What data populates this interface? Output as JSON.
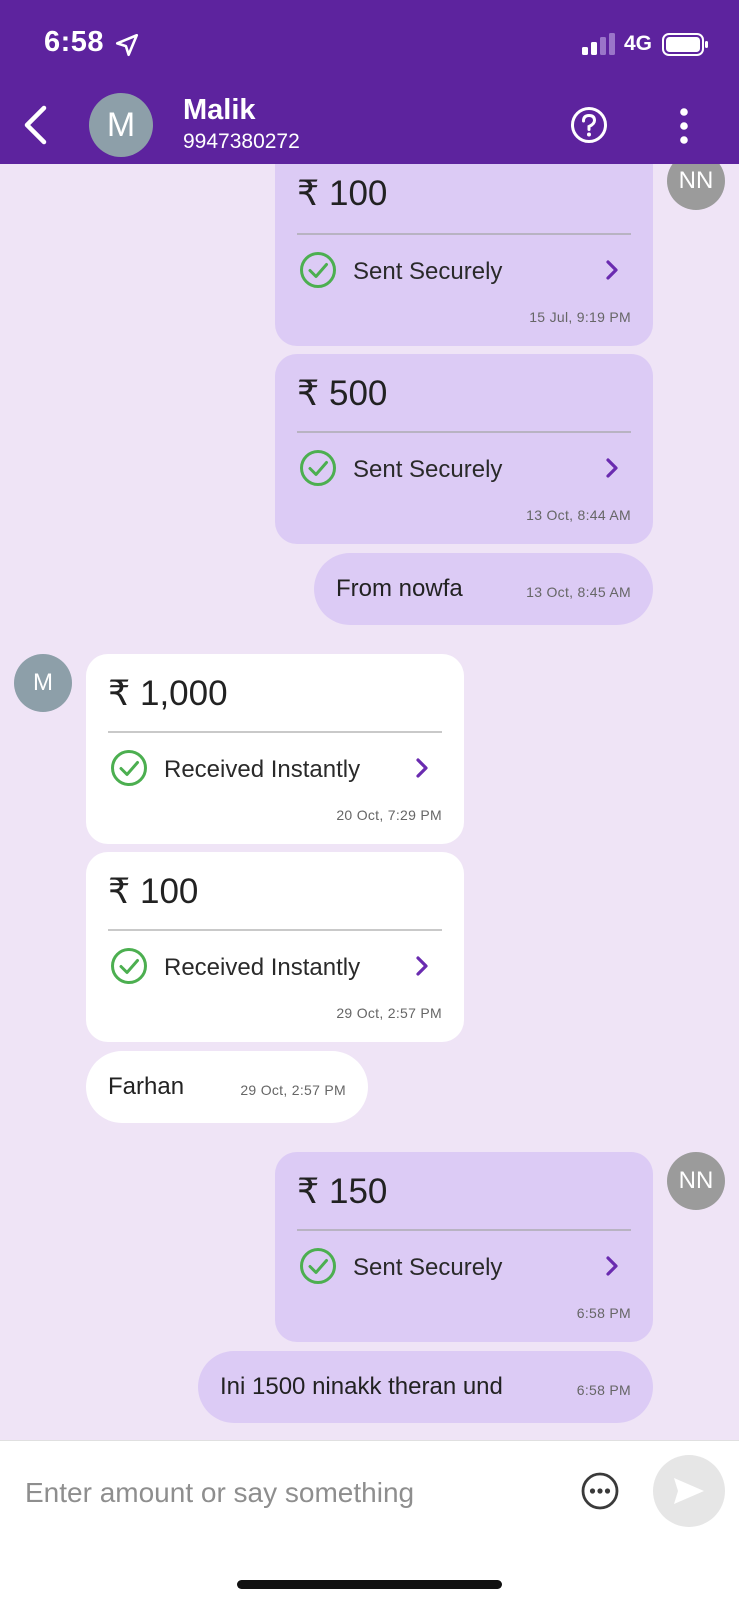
{
  "status_bar": {
    "time": "6:58",
    "network": "4G"
  },
  "header": {
    "contact_name": "Malik",
    "contact_phone": "9947380272",
    "avatar_initial": "M"
  },
  "avatars": {
    "self": "NN",
    "contact": "M"
  },
  "messages": [
    {
      "type": "payment",
      "direction": "sent",
      "amount": "₹ 100",
      "status": "Sent Securely",
      "time": "15 Jul, 9:19 PM"
    },
    {
      "type": "payment",
      "direction": "sent",
      "amount": "₹ 500",
      "status": "Sent Securely",
      "time": "13 Oct, 8:44 AM"
    },
    {
      "type": "text",
      "direction": "sent",
      "text": "From nowfa",
      "time": "13 Oct, 8:45 AM"
    },
    {
      "type": "payment",
      "direction": "received",
      "amount": "₹ 1,000",
      "status": "Received Instantly",
      "time": "20 Oct, 7:29 PM"
    },
    {
      "type": "payment",
      "direction": "received",
      "amount": "₹ 100",
      "status": "Received Instantly",
      "time": "29 Oct, 2:57 PM"
    },
    {
      "type": "text",
      "direction": "received",
      "text": "Farhan",
      "time": "29 Oct, 2:57 PM"
    },
    {
      "type": "payment",
      "direction": "sent",
      "amount": "₹ 150",
      "status": "Sent Securely",
      "time": "6:58 PM"
    },
    {
      "type": "text",
      "direction": "sent",
      "text": "Ini 1500 ninakk theran und",
      "time": "6:58 PM"
    }
  ],
  "composer": {
    "placeholder": "Enter amount or say something"
  },
  "colors": {
    "brand": "#5d239e",
    "sent_bubble": "#dccbf5",
    "received_bubble": "#ffffff",
    "check": "#4caf50",
    "chevron": "#6a2bb0"
  }
}
